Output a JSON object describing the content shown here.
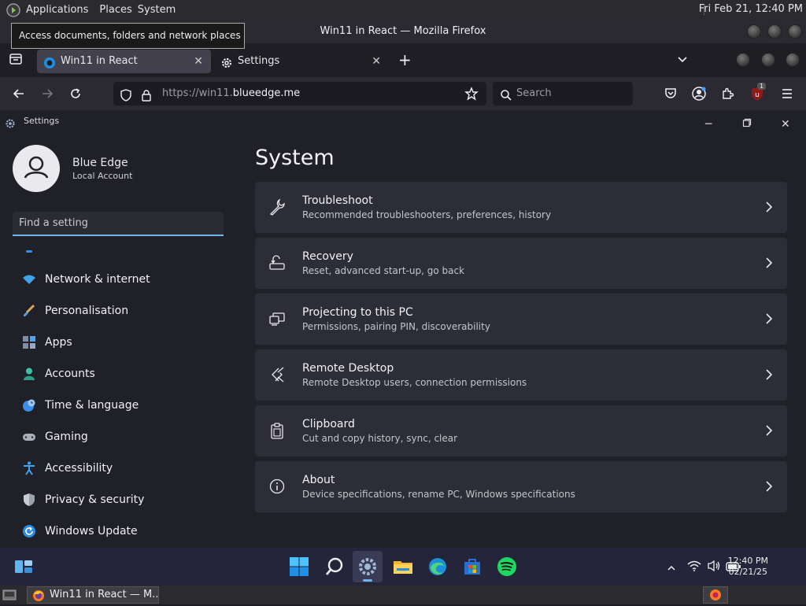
{
  "topbar": {
    "menus": [
      "Applications",
      "Places",
      "System"
    ],
    "clock": "Fri Feb 21, 12:40 PM"
  },
  "tooltip": "Access documents, folders and network places",
  "firefox": {
    "window_title": "Win11 in React — Mozilla Firefox",
    "tabs": [
      {
        "label": "Win11 in React",
        "active": true
      },
      {
        "label": "Settings",
        "active": false
      }
    ],
    "url_prefix": "https://win11.",
    "url_domain": "blueedge.me",
    "search_placeholder": "Search",
    "ext_badge": "1"
  },
  "settings": {
    "window_title": "Settings",
    "user_name": "Blue Edge",
    "account_type": "Local Account",
    "search_placeholder": "Find a setting",
    "nav": [
      {
        "label": "Network & internet",
        "icon": "wifi-icon"
      },
      {
        "label": "Personalisation",
        "icon": "brush-icon"
      },
      {
        "label": "Apps",
        "icon": "apps-icon"
      },
      {
        "label": "Accounts",
        "icon": "accounts-icon"
      },
      {
        "label": "Time & language",
        "icon": "globe-clock-icon"
      },
      {
        "label": "Gaming",
        "icon": "gamepad-icon"
      },
      {
        "label": "Accessibility",
        "icon": "accessibility-icon"
      },
      {
        "label": "Privacy & security",
        "icon": "shield-icon"
      },
      {
        "label": "Windows Update",
        "icon": "update-icon"
      }
    ],
    "page_title": "System",
    "cards": [
      {
        "title": "Troubleshoot",
        "subtitle": "Recommended troubleshooters, preferences, history",
        "icon": "wrench-icon"
      },
      {
        "title": "Recovery",
        "subtitle": "Reset, advanced start-up, go back",
        "icon": "recovery-icon"
      },
      {
        "title": "Projecting to this PC",
        "subtitle": "Permissions, pairing PIN, discoverability",
        "icon": "projecting-icon"
      },
      {
        "title": "Remote Desktop",
        "subtitle": "Remote Desktop users, connection permissions",
        "icon": "remote-desktop-icon"
      },
      {
        "title": "Clipboard",
        "subtitle": "Cut and copy history, sync, clear",
        "icon": "clipboard-icon"
      },
      {
        "title": "About",
        "subtitle": "Device specifications, rename PC, Windows specifications",
        "icon": "info-icon"
      }
    ]
  },
  "win_taskbar": {
    "time": "12:40 PM",
    "date": "02/21/25"
  },
  "bottombar": {
    "task_label": "Win11 in React — M..."
  },
  "colors": {
    "accent": "#6cb6e8",
    "card_bg": "#2d2d37",
    "app_bg": "#202029"
  }
}
